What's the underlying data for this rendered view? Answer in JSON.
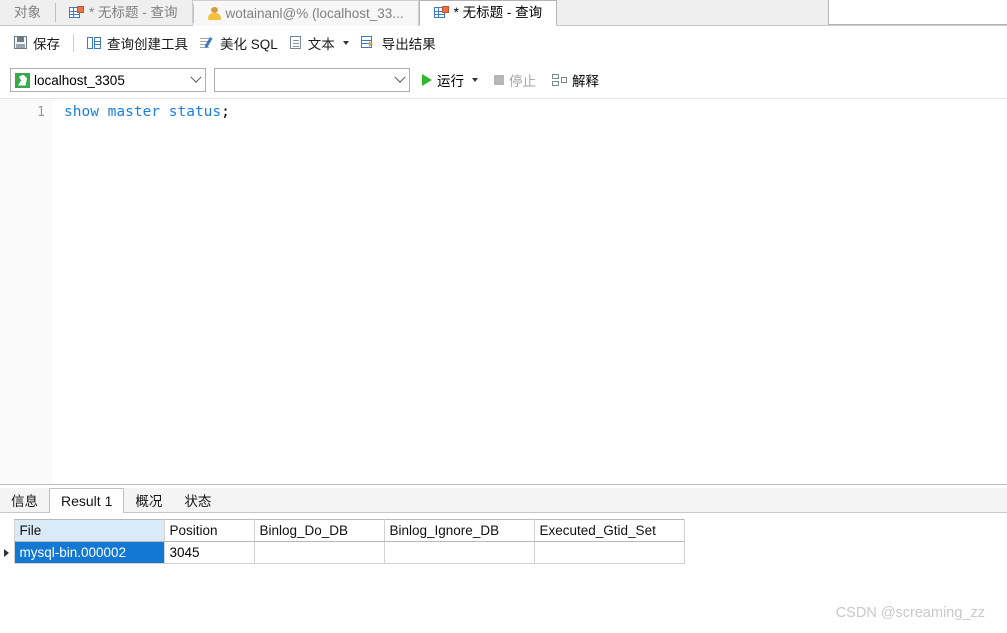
{
  "tabstrip": {
    "tabs": [
      {
        "label": "对象",
        "icon": "none",
        "state": "inactive"
      },
      {
        "label": "* 无标题 - 查询",
        "icon": "query-icon",
        "state": "inactive"
      },
      {
        "label": "wotainanl@% (localhost_33...",
        "icon": "user-icon",
        "state": "inactive-elevated"
      },
      {
        "label": "* 无标题 - 查询",
        "icon": "query-icon",
        "state": "active"
      }
    ]
  },
  "toolbar": {
    "save_label": "保存",
    "query_builder_label": "查询创建工具",
    "beautify_sql_label": "美化 SQL",
    "text_label": "文本",
    "export_result_label": "导出结果"
  },
  "connbar": {
    "connection_value": "localhost_3305",
    "database_value": "",
    "run_label": "运行",
    "stop_label": "停止",
    "explain_label": "解释"
  },
  "editor": {
    "line_number": "1",
    "code_keywords": "show master status",
    "code_punct": ";"
  },
  "result_panel": {
    "tabs": [
      {
        "label": "信息",
        "state": "inactive"
      },
      {
        "label": "Result 1",
        "state": "active"
      },
      {
        "label": "概况",
        "state": "inactive"
      },
      {
        "label": "状态",
        "state": "inactive"
      }
    ],
    "grid": {
      "columns": [
        "File",
        "Position",
        "Binlog_Do_DB",
        "Binlog_Ignore_DB",
        "Executed_Gtid_Set"
      ],
      "selected_column": "File",
      "rows": [
        {
          "File": "mysql-bin.000002",
          "Position": "3045",
          "Binlog_Do_DB": "",
          "Binlog_Ignore_DB": "",
          "Executed_Gtid_Set": ""
        }
      ]
    }
  },
  "watermark": {
    "text": "CSDN @screaming_zz"
  },
  "colors": {
    "accent_blue": "#1378d4",
    "selected_header": "#dbeaf7",
    "sql_keyword": "#1a7fe8",
    "run_green": "#2eb82e",
    "tabstrip_bg": "#efefef"
  }
}
